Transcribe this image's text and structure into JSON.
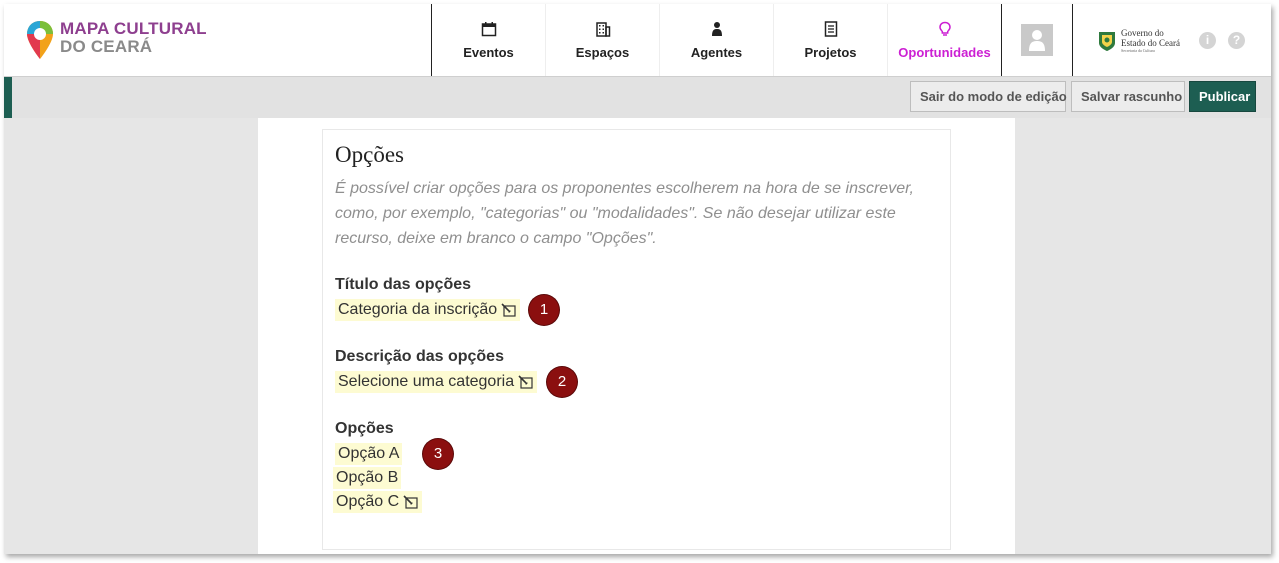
{
  "logo": {
    "line1": "MAPA CULTURAL",
    "line2": "DO CEARÁ"
  },
  "nav": [
    {
      "label": "Eventos",
      "icon": "calendar-icon"
    },
    {
      "label": "Espaços",
      "icon": "building-icon"
    },
    {
      "label": "Agentes",
      "icon": "person-icon"
    },
    {
      "label": "Projetos",
      "icon": "document-icon"
    },
    {
      "label": "Oportunidades",
      "icon": "lightbulb-icon"
    }
  ],
  "gov": {
    "line1": "Governo do",
    "line2": "Estado do Ceará",
    "line3": "Secretaria da Cultura"
  },
  "toolbar": {
    "exit_label": "Sair do modo de edição",
    "draft_label": "Salvar rascunho",
    "publish_label": "Publicar"
  },
  "options": {
    "heading": "Opções",
    "description": "É possível criar opções para os proponentes escolherem na hora de se inscrever, como, por exemplo, \"categorias\" ou \"modalidades\". Se não desejar utilizar este recurso, deixe em branco o campo \"Opções\".",
    "title_label": "Título das opções",
    "title_value": "Categoria da inscrição",
    "desc_label": "Descrição das opções",
    "desc_value": "Selecione uma categoria",
    "list_label": "Opções",
    "items": [
      "Opção A",
      "Opção B",
      "Opção C"
    ]
  },
  "badges": [
    "1",
    "2",
    "3"
  ],
  "colors": {
    "accent": "#1d5e52",
    "active_nav": "#cc1fd3",
    "badge": "#8b0f0f",
    "editable_bg": "#fdfbd2",
    "brand_purple": "#8e3f8f"
  }
}
